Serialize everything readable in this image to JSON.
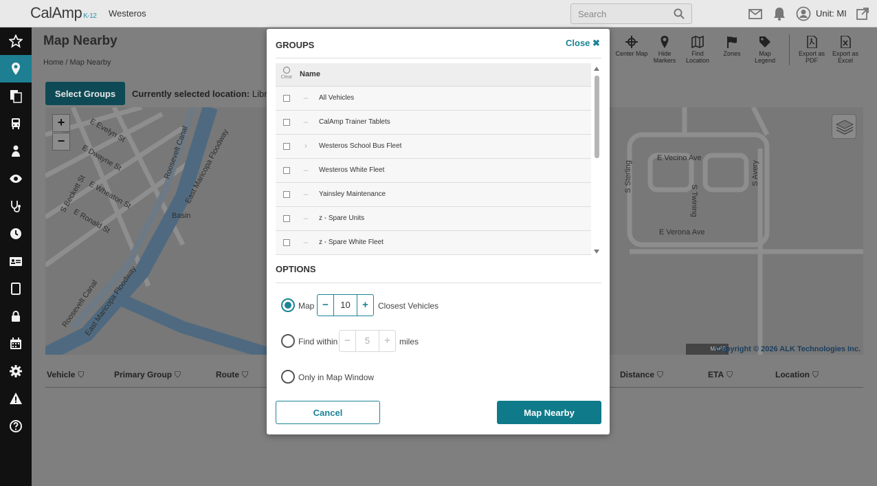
{
  "header": {
    "logo_text": "CalAmp",
    "logo_suffix": "K-12",
    "tenant": "Westeros",
    "search_placeholder": "Search",
    "unit_label": "Unit: MI"
  },
  "sidebar": {
    "items": [
      {
        "icon": "star-icon"
      },
      {
        "icon": "map-pin-icon",
        "active": true
      },
      {
        "icon": "documents-icon"
      },
      {
        "icon": "bus-icon"
      },
      {
        "icon": "driver-icon"
      },
      {
        "icon": "eye-icon"
      },
      {
        "icon": "stethoscope-icon"
      },
      {
        "icon": "clock-icon"
      },
      {
        "icon": "id-card-icon"
      },
      {
        "icon": "tablet-icon"
      },
      {
        "icon": "lock-icon"
      },
      {
        "icon": "calendar-icon"
      },
      {
        "icon": "gear-icon"
      },
      {
        "icon": "warning-icon"
      },
      {
        "icon": "help-icon"
      }
    ]
  },
  "page": {
    "title": "Map Nearby",
    "breadcrumb": "Home / Map Nearby",
    "select_groups_label": "Select Groups",
    "current_location_label": "Currently selected location:",
    "current_location_value": "Librar"
  },
  "toolbar": {
    "center_map": "Center Map",
    "hide_markers": "Hide Markers",
    "find_location": "Find Location",
    "zones": "Zones",
    "map_legend": "Map Legend",
    "export_pdf": "Export as PDF",
    "export_excel": "Export as Excel"
  },
  "map": {
    "zoom_in": "+",
    "zoom_out": "−",
    "copyright": "Copyright © 2026 ALK Technologies Inc.",
    "alk_label": "MAPS",
    "streets": {
      "evelyn": "E Evelyn St",
      "dwayne": "E Dwayne St",
      "wheaton": "E Wheaton St",
      "ronald": "E Ronald St",
      "beckett": "S Beckett St",
      "roosevelt_canal": "Roosevelt Canal",
      "maricopa_floodway": "East Maricopa Floodway",
      "basin": "Basin",
      "roosevelt_canal_2": "Roosevelt Canal",
      "maricopa_floodway_2": "East Maricopa Floodway",
      "vecino": "E Vecino Ave",
      "verona": "E Verona Ave",
      "sterling": "S Sterling",
      "twining": "S Twining",
      "avery": "S Avery"
    }
  },
  "table": {
    "columns": [
      "Vehicle",
      "Primary Group",
      "Route",
      "Distance",
      "ETA",
      "Location"
    ]
  },
  "modal": {
    "groups_title": "GROUPS",
    "close_label": "Close ✖",
    "clear_label": "Clear",
    "name_header": "Name",
    "groups": [
      {
        "name": "All Vehicles",
        "expander": "–"
      },
      {
        "name": "CalAmp Trainer Tablets",
        "expander": "–"
      },
      {
        "name": "Westeros School Bus Fleet",
        "expander": "›"
      },
      {
        "name": "Westeros White Fleet",
        "expander": "–"
      },
      {
        "name": "Yainsley Maintenance",
        "expander": "–"
      },
      {
        "name": "z - Spare Units",
        "expander": "–"
      },
      {
        "name": "z - Spare White Fleet",
        "expander": "–"
      }
    ],
    "options_title": "OPTIONS",
    "option_map_label": "Map",
    "option_map_value": "10",
    "option_map_suffix": "Closest Vehicles",
    "option_find_label": "Find within",
    "option_find_value": "5",
    "option_find_suffix": "miles",
    "option_window_label": "Only in Map Window",
    "stepper_minus": "−",
    "stepper_plus": "+",
    "cancel_label": "Cancel",
    "map_nearby_label": "Map Nearby"
  }
}
